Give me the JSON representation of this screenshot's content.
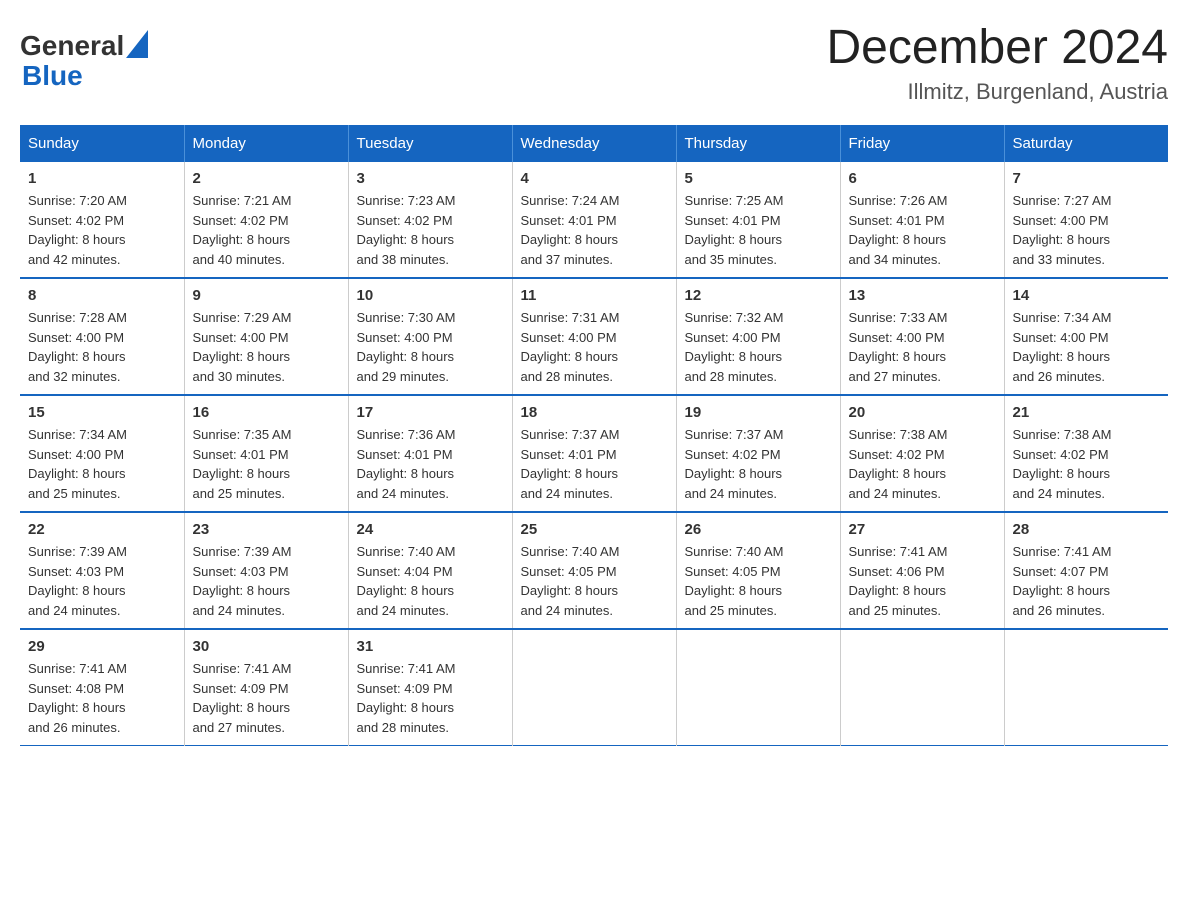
{
  "header": {
    "logo_line1": "General",
    "logo_line2": "Blue",
    "month_title": "December 2024",
    "location": "Illmitz, Burgenland, Austria"
  },
  "days_of_week": [
    "Sunday",
    "Monday",
    "Tuesday",
    "Wednesday",
    "Thursday",
    "Friday",
    "Saturday"
  ],
  "weeks": [
    [
      {
        "day": "1",
        "sunrise": "7:20 AM",
        "sunset": "4:02 PM",
        "daylight": "8 hours and 42 minutes."
      },
      {
        "day": "2",
        "sunrise": "7:21 AM",
        "sunset": "4:02 PM",
        "daylight": "8 hours and 40 minutes."
      },
      {
        "day": "3",
        "sunrise": "7:23 AM",
        "sunset": "4:02 PM",
        "daylight": "8 hours and 38 minutes."
      },
      {
        "day": "4",
        "sunrise": "7:24 AM",
        "sunset": "4:01 PM",
        "daylight": "8 hours and 37 minutes."
      },
      {
        "day": "5",
        "sunrise": "7:25 AM",
        "sunset": "4:01 PM",
        "daylight": "8 hours and 35 minutes."
      },
      {
        "day": "6",
        "sunrise": "7:26 AM",
        "sunset": "4:01 PM",
        "daylight": "8 hours and 34 minutes."
      },
      {
        "day": "7",
        "sunrise": "7:27 AM",
        "sunset": "4:00 PM",
        "daylight": "8 hours and 33 minutes."
      }
    ],
    [
      {
        "day": "8",
        "sunrise": "7:28 AM",
        "sunset": "4:00 PM",
        "daylight": "8 hours and 32 minutes."
      },
      {
        "day": "9",
        "sunrise": "7:29 AM",
        "sunset": "4:00 PM",
        "daylight": "8 hours and 30 minutes."
      },
      {
        "day": "10",
        "sunrise": "7:30 AM",
        "sunset": "4:00 PM",
        "daylight": "8 hours and 29 minutes."
      },
      {
        "day": "11",
        "sunrise": "7:31 AM",
        "sunset": "4:00 PM",
        "daylight": "8 hours and 28 minutes."
      },
      {
        "day": "12",
        "sunrise": "7:32 AM",
        "sunset": "4:00 PM",
        "daylight": "8 hours and 28 minutes."
      },
      {
        "day": "13",
        "sunrise": "7:33 AM",
        "sunset": "4:00 PM",
        "daylight": "8 hours and 27 minutes."
      },
      {
        "day": "14",
        "sunrise": "7:34 AM",
        "sunset": "4:00 PM",
        "daylight": "8 hours and 26 minutes."
      }
    ],
    [
      {
        "day": "15",
        "sunrise": "7:34 AM",
        "sunset": "4:00 PM",
        "daylight": "8 hours and 25 minutes."
      },
      {
        "day": "16",
        "sunrise": "7:35 AM",
        "sunset": "4:01 PM",
        "daylight": "8 hours and 25 minutes."
      },
      {
        "day": "17",
        "sunrise": "7:36 AM",
        "sunset": "4:01 PM",
        "daylight": "8 hours and 24 minutes."
      },
      {
        "day": "18",
        "sunrise": "7:37 AM",
        "sunset": "4:01 PM",
        "daylight": "8 hours and 24 minutes."
      },
      {
        "day": "19",
        "sunrise": "7:37 AM",
        "sunset": "4:02 PM",
        "daylight": "8 hours and 24 minutes."
      },
      {
        "day": "20",
        "sunrise": "7:38 AM",
        "sunset": "4:02 PM",
        "daylight": "8 hours and 24 minutes."
      },
      {
        "day": "21",
        "sunrise": "7:38 AM",
        "sunset": "4:02 PM",
        "daylight": "8 hours and 24 minutes."
      }
    ],
    [
      {
        "day": "22",
        "sunrise": "7:39 AM",
        "sunset": "4:03 PM",
        "daylight": "8 hours and 24 minutes."
      },
      {
        "day": "23",
        "sunrise": "7:39 AM",
        "sunset": "4:03 PM",
        "daylight": "8 hours and 24 minutes."
      },
      {
        "day": "24",
        "sunrise": "7:40 AM",
        "sunset": "4:04 PM",
        "daylight": "8 hours and 24 minutes."
      },
      {
        "day": "25",
        "sunrise": "7:40 AM",
        "sunset": "4:05 PM",
        "daylight": "8 hours and 24 minutes."
      },
      {
        "day": "26",
        "sunrise": "7:40 AM",
        "sunset": "4:05 PM",
        "daylight": "8 hours and 25 minutes."
      },
      {
        "day": "27",
        "sunrise": "7:41 AM",
        "sunset": "4:06 PM",
        "daylight": "8 hours and 25 minutes."
      },
      {
        "day": "28",
        "sunrise": "7:41 AM",
        "sunset": "4:07 PM",
        "daylight": "8 hours and 26 minutes."
      }
    ],
    [
      {
        "day": "29",
        "sunrise": "7:41 AM",
        "sunset": "4:08 PM",
        "daylight": "8 hours and 26 minutes."
      },
      {
        "day": "30",
        "sunrise": "7:41 AM",
        "sunset": "4:09 PM",
        "daylight": "8 hours and 27 minutes."
      },
      {
        "day": "31",
        "sunrise": "7:41 AM",
        "sunset": "4:09 PM",
        "daylight": "8 hours and 28 minutes."
      },
      null,
      null,
      null,
      null
    ]
  ],
  "labels": {
    "sunrise": "Sunrise:",
    "sunset": "Sunset:",
    "daylight": "Daylight:"
  }
}
